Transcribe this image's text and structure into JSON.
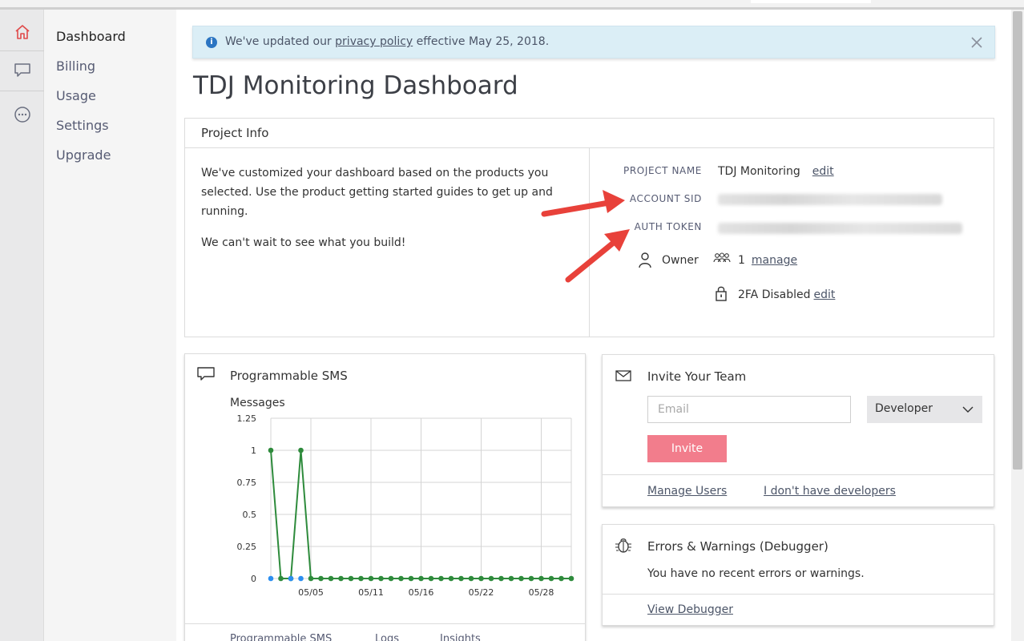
{
  "rail": {
    "icons": [
      "home-icon",
      "chat-icon",
      "more-icon"
    ]
  },
  "nav": {
    "items": [
      "Dashboard",
      "Billing",
      "Usage",
      "Settings",
      "Upgrade"
    ],
    "active": "Dashboard"
  },
  "banner": {
    "text_before": "We've updated our ",
    "link": "privacy policy",
    "text_after": " effective May 25, 2018."
  },
  "page": {
    "title": "TDJ Monitoring Dashboard"
  },
  "project_info": {
    "header": "Project Info",
    "para1": "We've customized your dashboard based on the products you selected. Use the product getting started guides to get up and running.",
    "para2": "We can't wait to see what you build!",
    "project_name_label": "PROJECT NAME",
    "project_name": "TDJ Monitoring",
    "edit_label": "edit",
    "account_sid_label": "ACCOUNT SID",
    "auth_token_label": "AUTH TOKEN",
    "owner_label": "Owner",
    "members_count": "1",
    "manage_label": "manage",
    "twofa_label": "2FA Disabled",
    "twofa_edit_label": "edit"
  },
  "sms": {
    "title": "Programmable SMS",
    "tabs": [
      "Programmable SMS",
      "Logs",
      "Insights"
    ]
  },
  "chart_data": {
    "type": "line",
    "title": "Messages",
    "ylim": [
      0,
      1.25
    ],
    "yticks": [
      "1.25",
      "1",
      "0.75",
      "0.5",
      "0.25",
      "0"
    ],
    "xtick_labels": [
      "05/05",
      "05/11",
      "05/16",
      "05/22",
      "05/28"
    ],
    "x": [
      "05/01",
      "05/02",
      "05/03",
      "05/04",
      "05/05",
      "05/06",
      "05/07",
      "05/08",
      "05/09",
      "05/10",
      "05/11",
      "05/12",
      "05/13",
      "05/14",
      "05/15",
      "05/16",
      "05/17",
      "05/18",
      "05/19",
      "05/20",
      "05/21",
      "05/22",
      "05/23",
      "05/24",
      "05/25",
      "05/26",
      "05/27",
      "05/28",
      "05/29",
      "05/30",
      "05/31"
    ],
    "series": [
      {
        "color": "#2e8b3c",
        "values": [
          1,
          0,
          0,
          1,
          0,
          0,
          0,
          0,
          0,
          0,
          0,
          0,
          0,
          0,
          0,
          0,
          0,
          0,
          0,
          0,
          0,
          0,
          0,
          0,
          0,
          0,
          0,
          0,
          0,
          0,
          0
        ]
      },
      {
        "color": "#2b8ef0",
        "values": [
          0,
          null,
          0,
          0,
          null,
          null,
          null,
          null,
          null,
          null,
          null,
          null,
          null,
          null,
          null,
          null,
          null,
          null,
          null,
          null,
          null,
          null,
          null,
          null,
          null,
          null,
          null,
          null,
          null,
          null,
          null
        ]
      }
    ],
    "grid": true
  },
  "invite": {
    "title": "Invite Your Team",
    "email_placeholder": "Email",
    "role_value": "Developer",
    "button": "Invite",
    "manage_users": "Manage Users",
    "no_developers": "I don't have developers"
  },
  "errors": {
    "title": "Errors & Warnings (Debugger)",
    "message": "You have no recent errors or warnings.",
    "link": "View Debugger"
  }
}
